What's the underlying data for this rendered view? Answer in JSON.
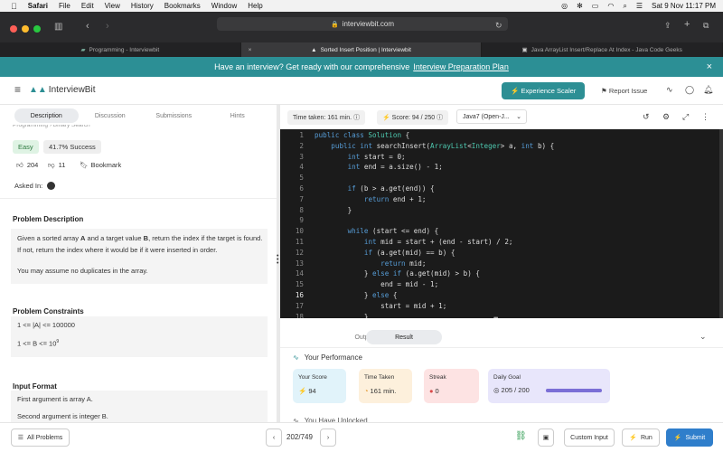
{
  "menubar": {
    "app": "Safari",
    "items": [
      "File",
      "Edit",
      "View",
      "History",
      "Bookmarks",
      "Window",
      "Help"
    ],
    "datetime": "Sat 9 Nov  11:17 PM"
  },
  "browser": {
    "url": "interviewbit.com",
    "tabs": [
      {
        "title": "Programming - Interviewbit"
      },
      {
        "title": "Sorted Insert Position | Interviewbit"
      },
      {
        "title": "Java ArrayList Insert/Replace At Index - Java Code Geeks"
      }
    ]
  },
  "banner": {
    "text": "Have an interview? Get ready with our comprehensive",
    "link": "Interview Preparation Plan"
  },
  "header": {
    "logo": "InterviewBit",
    "scaler_button": "Experience Scaler",
    "report_issue": "Report Issue"
  },
  "problem": {
    "tabs": [
      "Description",
      "Discussion",
      "Submissions",
      "Hints"
    ],
    "breadcrumb": "Programming › Binary Search",
    "difficulty": "Easy",
    "success": "41.7% Success",
    "likes": "204",
    "dislikes": "11",
    "bookmark": "Bookmark",
    "asked_in": "Asked In:",
    "desc_title": "Problem Description",
    "desc_p1_a": "Given a sorted array ",
    "desc_p1_b": "A",
    "desc_p1_c": " and a target value ",
    "desc_p1_d": "B",
    "desc_p1_e": ", return the index if the target is found. If not, return the index where it would be if it were inserted in order.",
    "desc_p2": "You may assume no duplicates in the array.",
    "constraints_title": "Problem Constraints",
    "constraint1": "1 <= |A| <= 100000",
    "constraint2": "1 <= B <= 10",
    "constraint2_exp": "9",
    "input_title": "Input Format",
    "input1": "First argument is array A.",
    "input2": "Second argument is integer B."
  },
  "editor_toolbar": {
    "time_taken": "Time taken: 161 min.",
    "score": "Score:  94 / 250",
    "language": "Java7 (Open-J..."
  },
  "code": {
    "lines": [
      {
        "n": "1",
        "t": "public class Solution {"
      },
      {
        "n": "2",
        "t": "    public int searchInsert(ArrayList<Integer> a, int b) {"
      },
      {
        "n": "3",
        "t": "        int start = 0;"
      },
      {
        "n": "4",
        "t": "        int end = a.size() - 1;"
      },
      {
        "n": "5",
        "t": ""
      },
      {
        "n": "6",
        "t": "        if (b > a.get(end)) {"
      },
      {
        "n": "7",
        "t": "            return end + 1;"
      },
      {
        "n": "8",
        "t": "        }"
      },
      {
        "n": "9",
        "t": ""
      },
      {
        "n": "10",
        "t": "        while (start <= end) {"
      },
      {
        "n": "11",
        "t": "            int mid = start + (end - start) / 2;"
      },
      {
        "n": "12",
        "t": "            if (a.get(mid) == b) {"
      },
      {
        "n": "13",
        "t": "                return mid;"
      },
      {
        "n": "14",
        "t": "            } else if (a.get(mid) > b) {"
      },
      {
        "n": "15",
        "t": "                end = mid - 1;"
      },
      {
        "n": "16",
        "t": "            } else {"
      },
      {
        "n": "17",
        "t": "                start = mid + 1;"
      },
      {
        "n": "18",
        "t": "            }"
      }
    ]
  },
  "result": {
    "tabs": [
      "Output",
      "Result"
    ],
    "performance_title": "Your Performance",
    "cards": [
      {
        "label": "Your Score",
        "value": "94"
      },
      {
        "label": "Time Taken",
        "value": "161 min."
      },
      {
        "label": "Streak",
        "value": "0"
      },
      {
        "label": "Daily Goal",
        "value": "205 / 200"
      }
    ],
    "unlocked": "You Have Unlocked"
  },
  "footer": {
    "all_problems": "All Problems",
    "pagination": "202/749",
    "custom_input": "Custom Input",
    "run": "Run",
    "submit": "Submit"
  },
  "colors": {
    "teal": "#2d8f94",
    "submit_blue": "#2f7ecb",
    "code_bg": "#1b1b1b"
  }
}
